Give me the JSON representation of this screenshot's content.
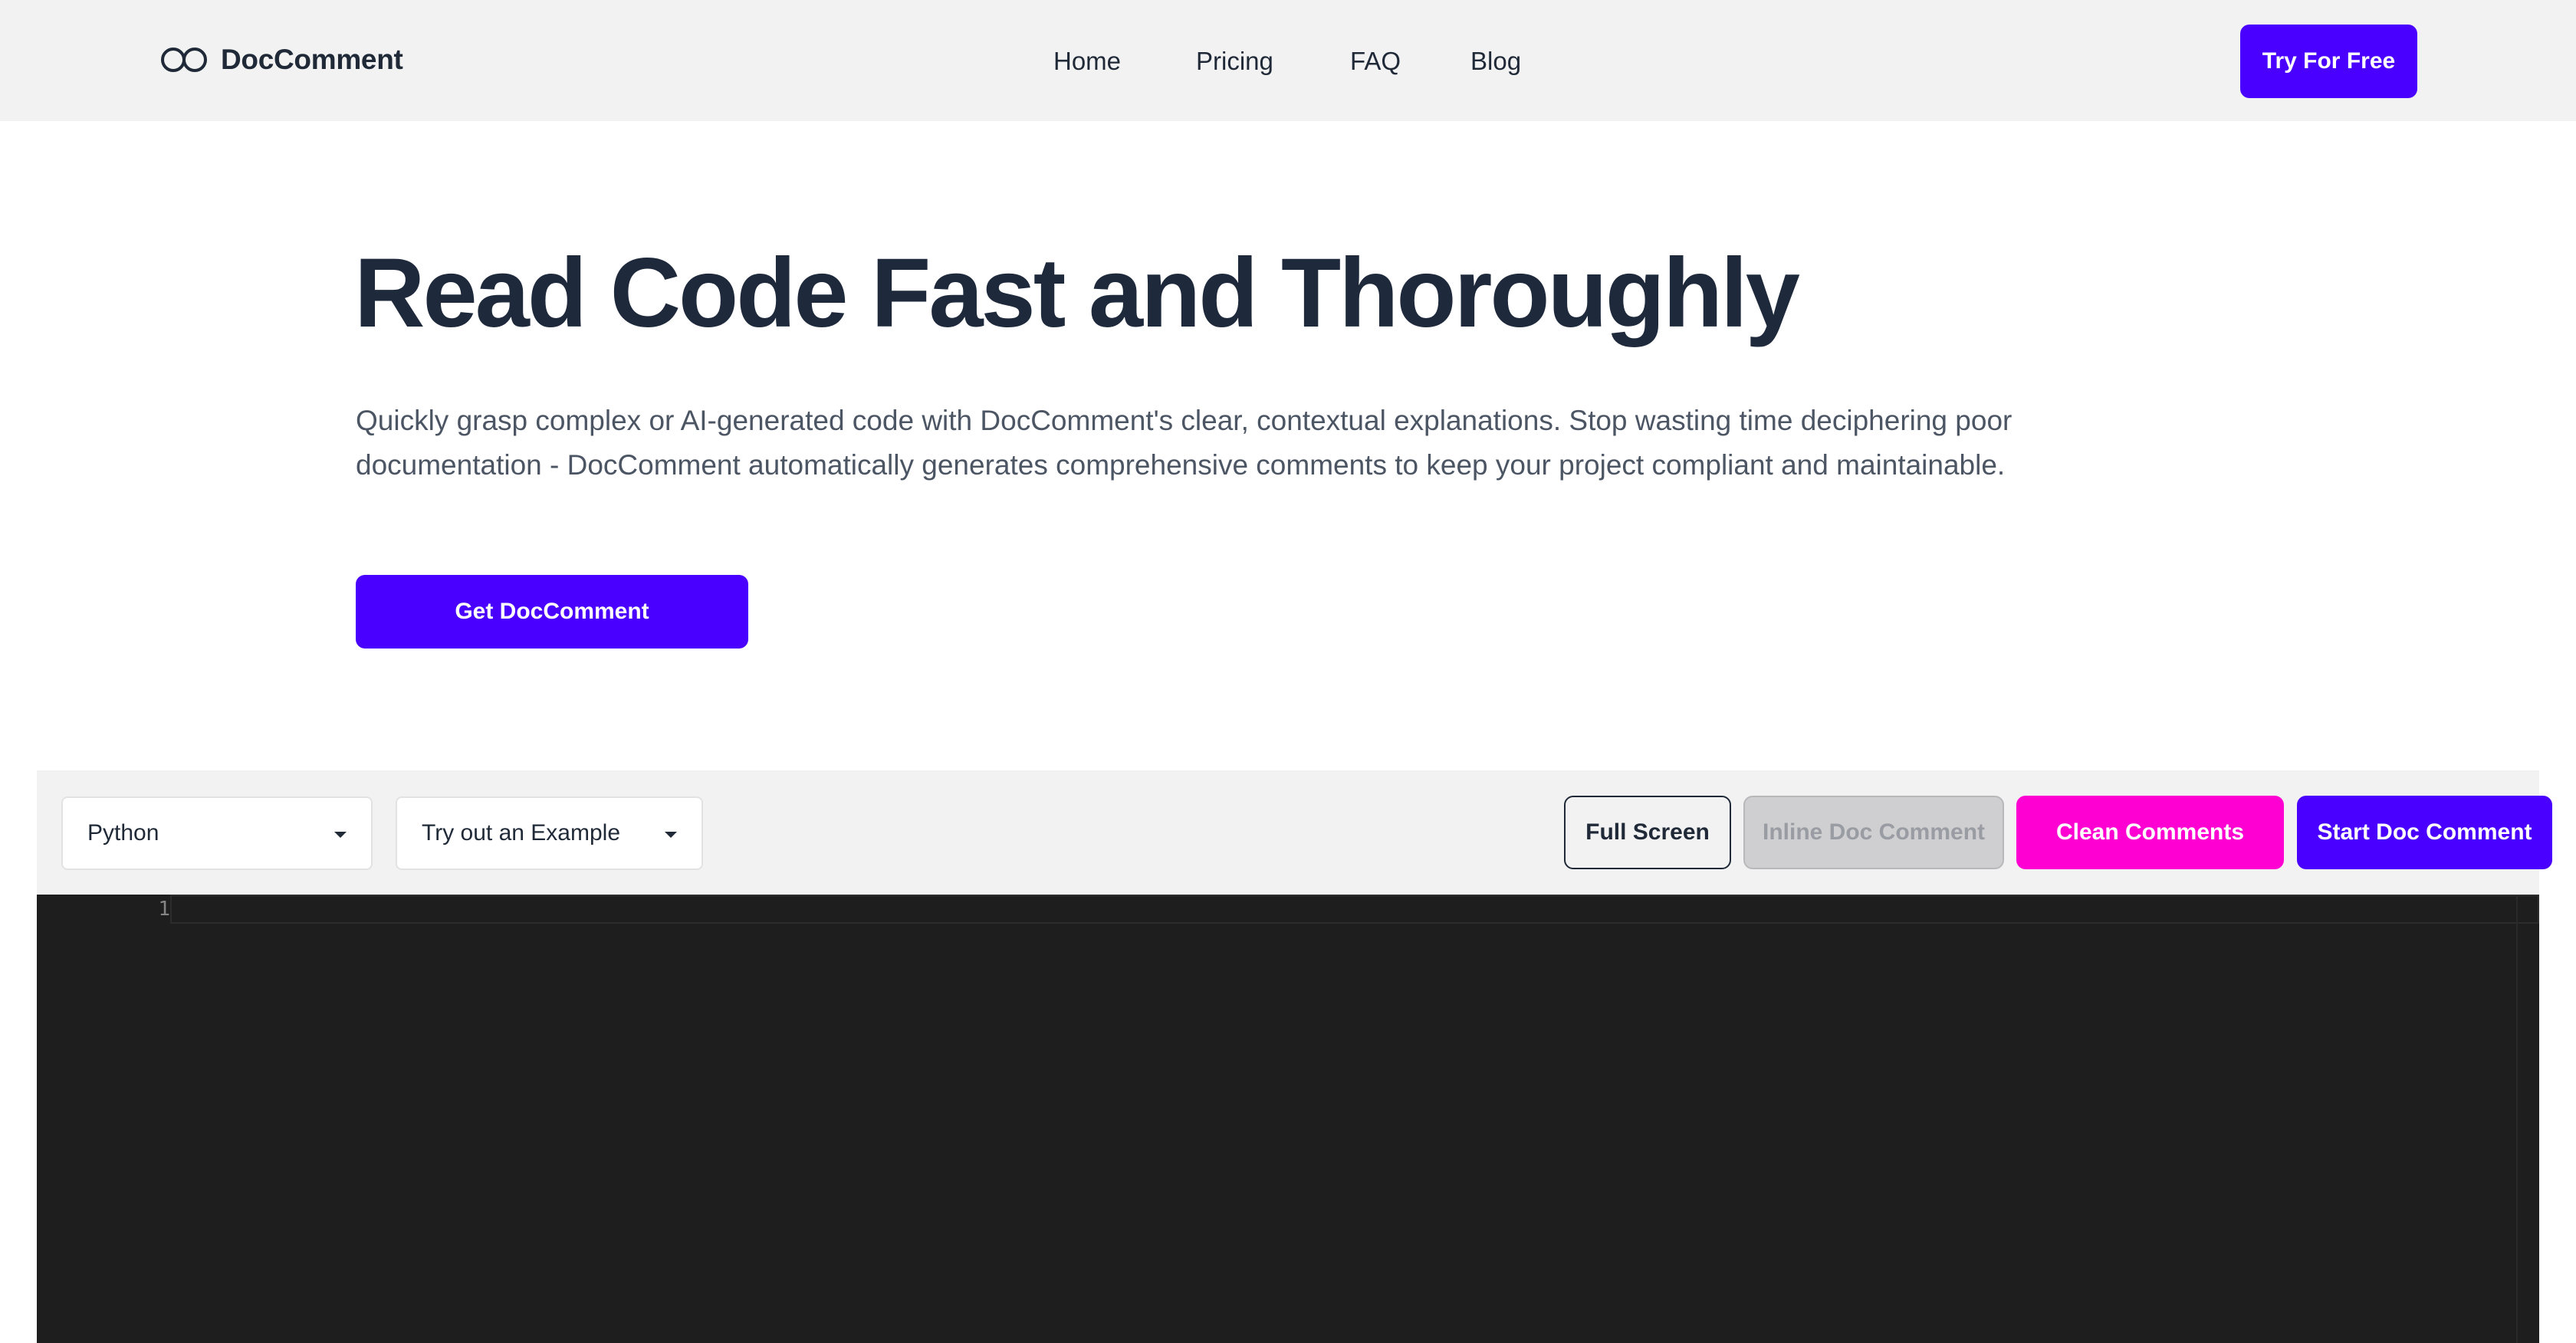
{
  "header": {
    "brand": "DocComment",
    "nav": [
      {
        "label": "Home"
      },
      {
        "label": "Pricing"
      },
      {
        "label": "FAQ"
      },
      {
        "label": "Blog"
      }
    ],
    "cta_label": "Try For Free"
  },
  "hero": {
    "title": "Read Code Fast and Thoroughly",
    "description": "Quickly grasp complex or AI-generated code with DocComment's clear, contextual explanations. Stop wasting time deciphering poor documentation - DocComment automatically generates comprehensive comments to keep your project compliant and maintainable.",
    "cta_label": "Get DocComment"
  },
  "toolbar": {
    "language_select": {
      "value": "Python"
    },
    "example_select": {
      "value": "Try out an Example"
    },
    "full_screen_label": "Full Screen",
    "inline_doc_comment_label": "Inline Doc Comment",
    "clean_comments_label": "Clean Comments",
    "start_doc_comment_label": "Start Doc Comment"
  },
  "editor": {
    "line_numbers": [
      "1"
    ]
  },
  "colors": {
    "accent": "#4a00ff",
    "magenta": "#ff00d3",
    "header_bg": "#f2f2f2",
    "editor_bg": "#1e1e1e",
    "title": "#1e293b"
  },
  "icons": {
    "logo": "infinity-rings-icon",
    "select_caret": "caret-down-icon"
  }
}
